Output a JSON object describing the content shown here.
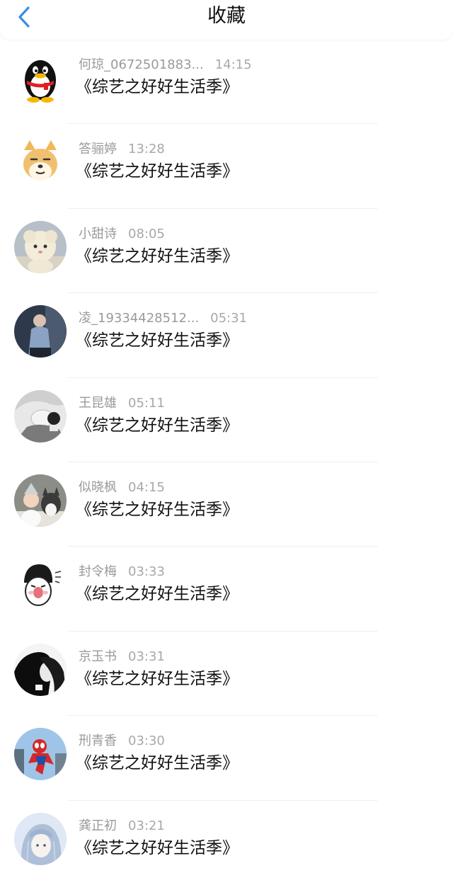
{
  "header": {
    "title": "收藏",
    "back_icon": "chevron-left-icon",
    "accent_color": "#3a8ee6"
  },
  "items": [
    {
      "name": "何琼_0672501883...",
      "time": "14:15",
      "text": "《综艺之好好生活季》",
      "avatar": "penguin-avatar"
    },
    {
      "name": "答骊婷",
      "time": "13:28",
      "text": "《综艺之好好生活季》",
      "avatar": "shiba-dog-avatar"
    },
    {
      "name": "小甜诗",
      "time": "08:05",
      "text": "《综艺之好好生活季》",
      "avatar": "plush-sheep-avatar"
    },
    {
      "name": "凌_19334428512...",
      "time": "05:31",
      "text": "《综艺之好好生活季》",
      "avatar": "person-photo-avatar"
    },
    {
      "name": "王昆雄",
      "time": "05:11",
      "text": "《综艺之好好生活季》",
      "avatar": "grayscale-portrait-avatar"
    },
    {
      "name": "似晓枫",
      "time": "04:15",
      "text": "《综艺之好好生活季》",
      "avatar": "child-and-husky-avatar"
    },
    {
      "name": "封令梅",
      "time": "03:33",
      "text": "《综艺之好好生活季》",
      "avatar": "cartoon-sticker-avatar"
    },
    {
      "name": "京玉书",
      "time": "03:31",
      "text": "《综艺之好好生活季》",
      "avatar": "silhouette-couple-avatar"
    },
    {
      "name": "刑青香",
      "time": "03:30",
      "text": "《综艺之好好生活季》",
      "avatar": "spiderman-avatar"
    },
    {
      "name": "龚正初",
      "time": "03:21",
      "text": "《综艺之好好生活季》",
      "avatar": "anime-girl-avatar"
    }
  ]
}
